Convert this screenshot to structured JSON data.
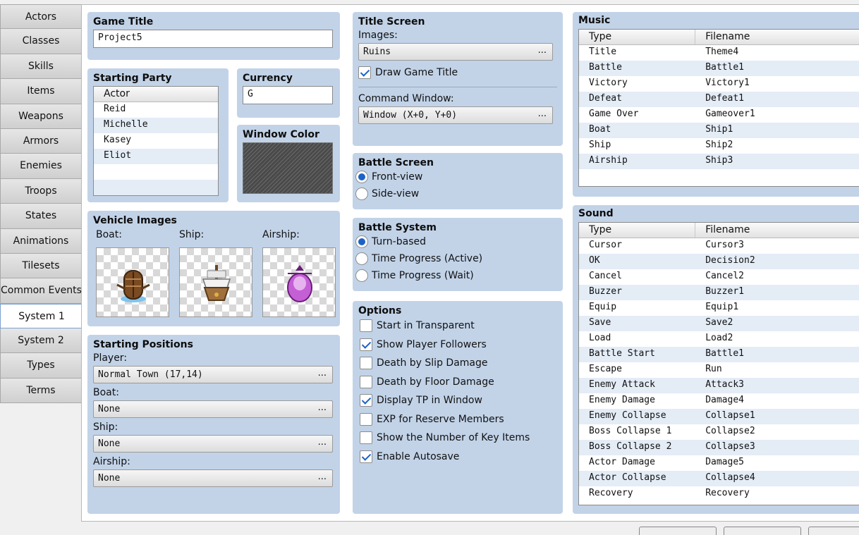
{
  "tabs": [
    "Actors",
    "Classes",
    "Skills",
    "Items",
    "Weapons",
    "Armors",
    "Enemies",
    "Troops",
    "States",
    "Animations",
    "Tilesets",
    "Common Events",
    "System 1",
    "System 2",
    "Types",
    "Terms"
  ],
  "active_tab": "System 1",
  "game_title": {
    "label": "Game Title",
    "value": "Project5"
  },
  "starting_party": {
    "label": "Starting Party",
    "header": "Actor",
    "members": [
      "Reid",
      "Michelle",
      "Kasey",
      "Eliot"
    ]
  },
  "currency": {
    "label": "Currency",
    "value": "G"
  },
  "window_color": {
    "label": "Window Color",
    "swatch": "#4a4a4a"
  },
  "vehicle_images": {
    "label": "Vehicle Images",
    "boat": {
      "label": "Boat:",
      "icon": "boat-icon"
    },
    "ship": {
      "label": "Ship:",
      "icon": "ship-icon"
    },
    "airship": {
      "label": "Airship:",
      "icon": "airship-icon"
    }
  },
  "starting_positions": {
    "label": "Starting Positions",
    "player_label": "Player:",
    "player_value": "Normal Town (17,14)",
    "boat_label": "Boat:",
    "boat_value": "None",
    "ship_label": "Ship:",
    "ship_value": "None",
    "airship_label": "Airship:",
    "airship_value": "None",
    "more": "..."
  },
  "title_screen": {
    "label": "Title Screen",
    "images_label": "Images:",
    "images_value": "Ruins",
    "draw_title_label": "Draw Game Title",
    "draw_title_checked": true,
    "command_window_label": "Command Window:",
    "command_window_value": "Window (X+0, Y+0)"
  },
  "battle_screen": {
    "label": "Battle Screen",
    "options": [
      "Front-view",
      "Side-view"
    ],
    "selected": 0
  },
  "battle_system": {
    "label": "Battle System",
    "options": [
      "Turn-based",
      "Time Progress (Active)",
      "Time Progress (Wait)"
    ],
    "selected": 0
  },
  "options": {
    "label": "Options",
    "items": [
      {
        "label": "Start in Transparent",
        "checked": false
      },
      {
        "label": "Show Player Followers",
        "checked": true
      },
      {
        "label": "Death by Slip Damage",
        "checked": false
      },
      {
        "label": "Death by Floor Damage",
        "checked": false
      },
      {
        "label": "Display TP in Window",
        "checked": true
      },
      {
        "label": "EXP for Reserve Members",
        "checked": false
      },
      {
        "label": "Show the Number of Key Items",
        "checked": false
      },
      {
        "label": "Enable Autosave",
        "checked": true
      }
    ]
  },
  "music": {
    "label": "Music",
    "headers": [
      "Type",
      "Filename"
    ],
    "rows": [
      [
        "Title",
        "Theme4"
      ],
      [
        "Battle",
        "Battle1"
      ],
      [
        "Victory",
        "Victory1"
      ],
      [
        "Defeat",
        "Defeat1"
      ],
      [
        "Game Over",
        "Gameover1"
      ],
      [
        "Boat",
        "Ship1"
      ],
      [
        "Ship",
        "Ship2"
      ],
      [
        "Airship",
        "Ship3"
      ]
    ]
  },
  "sound": {
    "label": "Sound",
    "headers": [
      "Type",
      "Filename"
    ],
    "rows": [
      [
        "Cursor",
        "Cursor3"
      ],
      [
        "OK",
        "Decision2"
      ],
      [
        "Cancel",
        "Cancel2"
      ],
      [
        "Buzzer",
        "Buzzer1"
      ],
      [
        "Equip",
        "Equip1"
      ],
      [
        "Save",
        "Save2"
      ],
      [
        "Load",
        "Load2"
      ],
      [
        "Battle Start",
        "Battle1"
      ],
      [
        "Escape",
        "Run"
      ],
      [
        "Enemy Attack",
        "Attack3"
      ],
      [
        "Enemy Damage",
        "Damage4"
      ],
      [
        "Enemy Collapse",
        "Collapse1"
      ],
      [
        "Boss Collapse 1",
        "Collapse2"
      ],
      [
        "Boss Collapse 2",
        "Collapse3"
      ],
      [
        "Actor Damage",
        "Damage5"
      ],
      [
        "Actor Collapse",
        "Collapse4"
      ],
      [
        "Recovery",
        "Recovery"
      ]
    ]
  },
  "colors": {
    "panel": "#c2d3e8",
    "accent": "#1d62c7",
    "row_alt": "#e4ecf6"
  }
}
